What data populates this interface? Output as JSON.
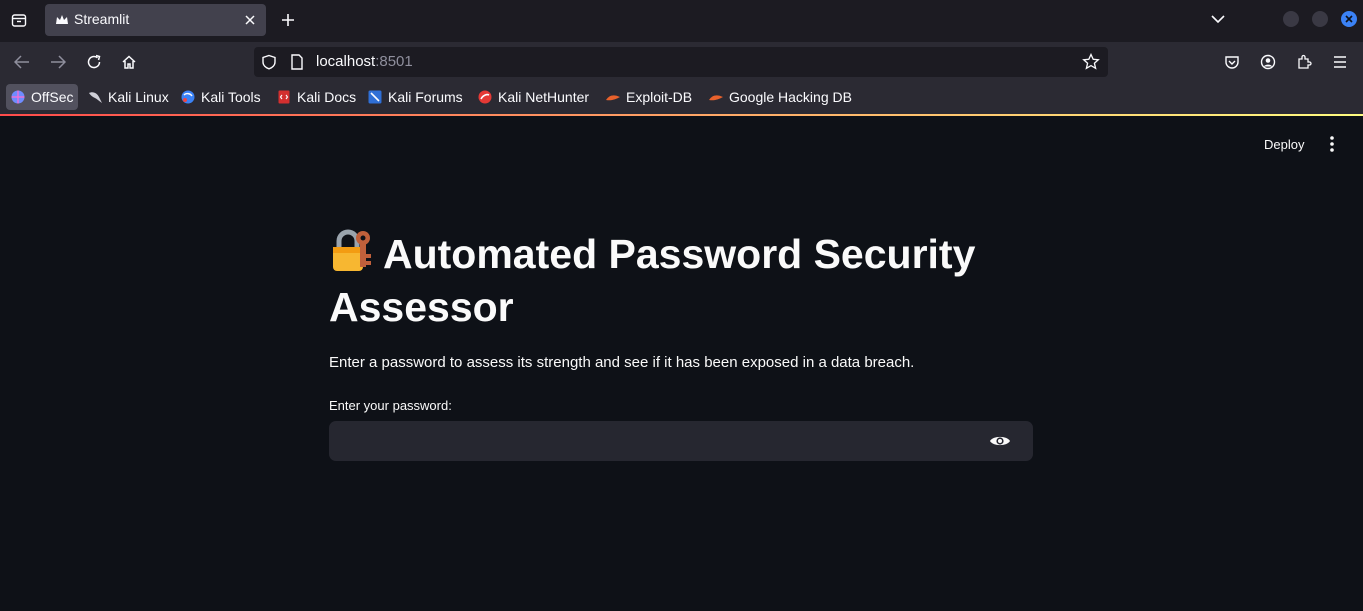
{
  "browser": {
    "tab": {
      "title": "Streamlit"
    },
    "url": {
      "host": "localhost",
      "port": ":8501"
    },
    "bookmarks": [
      {
        "label": "OffSec",
        "icon": "offsec-icon",
        "color": "#6f8cff"
      },
      {
        "label": "Kali Linux",
        "icon": "kali-dragon-icon",
        "color": "#1d1d1d"
      },
      {
        "label": "Kali Tools",
        "icon": "kali-tools-icon",
        "color": "#3b82f6"
      },
      {
        "label": "Kali Docs",
        "icon": "kali-docs-icon",
        "color": "#d32f2f"
      },
      {
        "label": "Kali Forums",
        "icon": "kali-forums-icon",
        "color": "#2f6fd6"
      },
      {
        "label": "Kali NetHunter",
        "icon": "nethunter-icon",
        "color": "#e53935"
      },
      {
        "label": "Exploit-DB",
        "icon": "exploit-db-icon",
        "color": "#e8612c"
      },
      {
        "label": "Google Hacking DB",
        "icon": "ghdb-icon",
        "color": "#e8612c"
      }
    ]
  },
  "app": {
    "deploy_label": "Deploy",
    "title": "Automated Password Security Assessor",
    "description": "Enter a password to assess its strength and see if it has been exposed in a data breach.",
    "password_label": "Enter your password:",
    "password_value": ""
  },
  "colors": {
    "background": "#0e1117",
    "input_bg": "#262730",
    "text": "#fafafa",
    "accent_red": "#ff4b4b"
  }
}
